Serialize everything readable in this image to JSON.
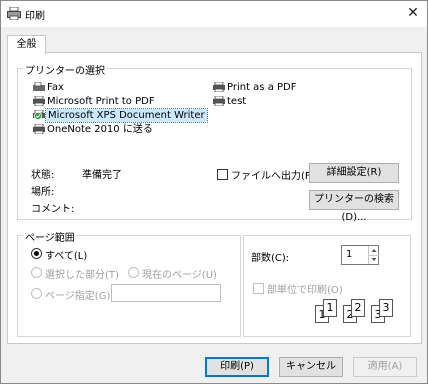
{
  "window": {
    "title": "印刷",
    "close_glyph": "✕"
  },
  "tabs": [
    {
      "label": "全般"
    }
  ],
  "printer_group": {
    "label": "プリンターの選択",
    "printers_left": [
      {
        "label": "Fax",
        "icon": "fax-icon",
        "selected": false
      },
      {
        "label": "Microsoft Print to PDF",
        "icon": "printer-icon",
        "selected": false
      },
      {
        "label": "Microsoft XPS Document Writer",
        "icon": "printer-default-icon",
        "selected": true
      },
      {
        "label": "OneNote 2010 に送る",
        "icon": "printer-icon",
        "selected": false
      }
    ],
    "printers_right": [
      {
        "label": "Print as a PDF",
        "icon": "printer-icon",
        "selected": false
      },
      {
        "label": "test",
        "icon": "printer-icon",
        "selected": false
      }
    ],
    "status_label": "状態:",
    "status_value": "準備完了",
    "location_label": "場所:",
    "comment_label": "コメント:",
    "print_to_file_label": "ファイルへ出力(F)",
    "preferences_button": "詳細設定(R)",
    "find_printer_button": "プリンターの検索(D)..."
  },
  "page_range": {
    "label": "ページ範囲",
    "all_label": "すべて(L)",
    "selection_label": "選択した部分(T)",
    "current_page_label": "現在のページ(U)",
    "pages_label": "ページ指定(G):",
    "pages_value": ""
  },
  "copies": {
    "label": "部数(C):",
    "value": "1",
    "collate_label": "部単位で印刷(O)",
    "collate_numbers": [
      "1",
      "1",
      "2",
      "2",
      "3",
      "3"
    ]
  },
  "buttons": {
    "print": "印刷(P)",
    "cancel": "キャンセル",
    "apply": "適用(A)"
  },
  "colors": {
    "selection": "#cce8ff",
    "accent": "#0078d7",
    "disabled": "#a0a0a0"
  }
}
